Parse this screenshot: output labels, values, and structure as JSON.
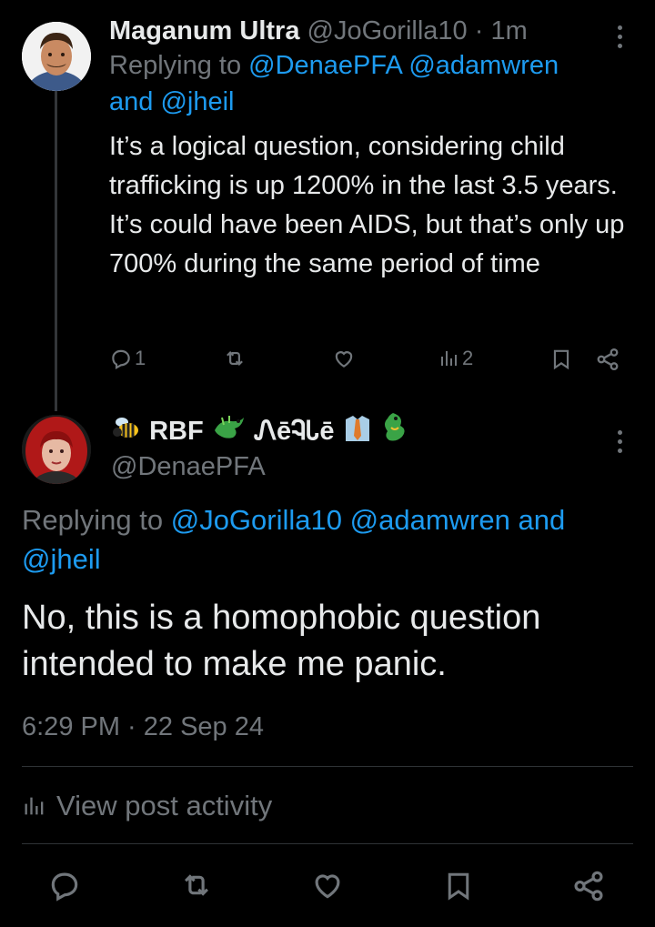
{
  "reply_tweet": {
    "author_name": "Maganum Ultra",
    "author_handle": "@JoGorilla10",
    "time_ago": "1m",
    "replying_to_prefix": "Replying to",
    "replying_to_first": "@DenaePFA",
    "replying_to_second": "@adamwren",
    "replying_to_and": "and",
    "replying_to_third": "@jheil",
    "text": "It’s a logical question, considering child trafficking is up 1200% in the last 3.5 years. It’s could have been AIDS, but that’s only up 700% during the same period of time",
    "reply_count": "1",
    "views_count": "2"
  },
  "main_tweet": {
    "author_name": "RBF",
    "author_name_script": "ᏁēᎸᏓē",
    "author_handle": "@DenaePFA",
    "replying_to_prefix": "Replying to",
    "replying_to_first": "@JoGorilla10",
    "replying_to_second": "@adamwren",
    "replying_to_and": "and",
    "replying_to_third": "@jheil",
    "text": "No, this is a homophobic question intended to make me panic.",
    "timestamp": "6:29 PM · 22 Sep 24",
    "activity_label": "View post activity"
  },
  "icons": [
    "more-icon",
    "reply-icon",
    "repost-icon",
    "like-icon",
    "views-icon",
    "bookmark-icon",
    "share-icon",
    "bee-emoji",
    "dragon-emoji",
    "shirt-tie-emoji"
  ],
  "colors": {
    "background": "#000000",
    "text": "#e7e9ea",
    "muted": "#71767b",
    "link": "#1d9bf0",
    "divider": "#2f3336"
  }
}
